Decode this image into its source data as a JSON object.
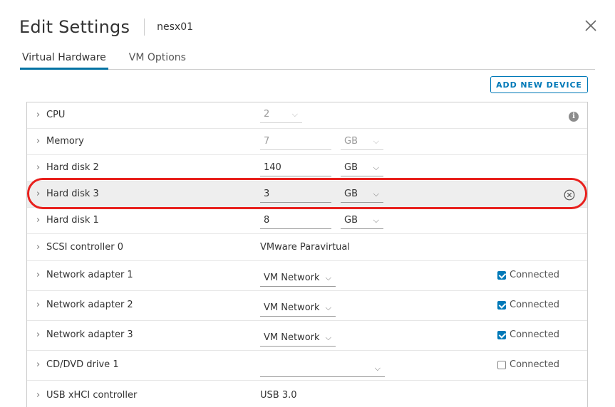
{
  "dialog": {
    "title": "Edit Settings",
    "vm_name": "nesx01"
  },
  "tabs": [
    {
      "label": "Virtual Hardware",
      "active": true
    },
    {
      "label": "VM Options",
      "active": false
    }
  ],
  "toolbar": {
    "add_device_label": "ADD NEW DEVICE"
  },
  "rows": [
    {
      "label": "CPU",
      "value": "2",
      "disabled": true
    },
    {
      "label": "Memory",
      "value": "7",
      "unit": "GB",
      "disabled": true
    },
    {
      "label": "Hard disk 2",
      "value": "140",
      "unit": "GB"
    },
    {
      "label": "Hard disk 3",
      "value": "3",
      "unit": "GB"
    },
    {
      "label": "Hard disk 1",
      "value": "8",
      "unit": "GB"
    },
    {
      "label": "SCSI controller 0",
      "value": "VMware Paravirtual"
    },
    {
      "label": "Network adapter 1",
      "value": "VM Network",
      "status": "Connected",
      "connected": true
    },
    {
      "label": "Network adapter 2",
      "value": "VM Network",
      "status": "Connected",
      "connected": true
    },
    {
      "label": "Network adapter 3",
      "value": "VM Network",
      "status": "Connected",
      "connected": true
    },
    {
      "label": "CD/DVD drive 1",
      "value": "",
      "status": "Connected",
      "connected": false
    },
    {
      "label": "USB xHCI controller",
      "value": "USB 3.0"
    }
  ],
  "colors": {
    "accent": "#0079b8",
    "highlight_ring": "#e8201d",
    "highlight_row": "#eeeeee"
  }
}
